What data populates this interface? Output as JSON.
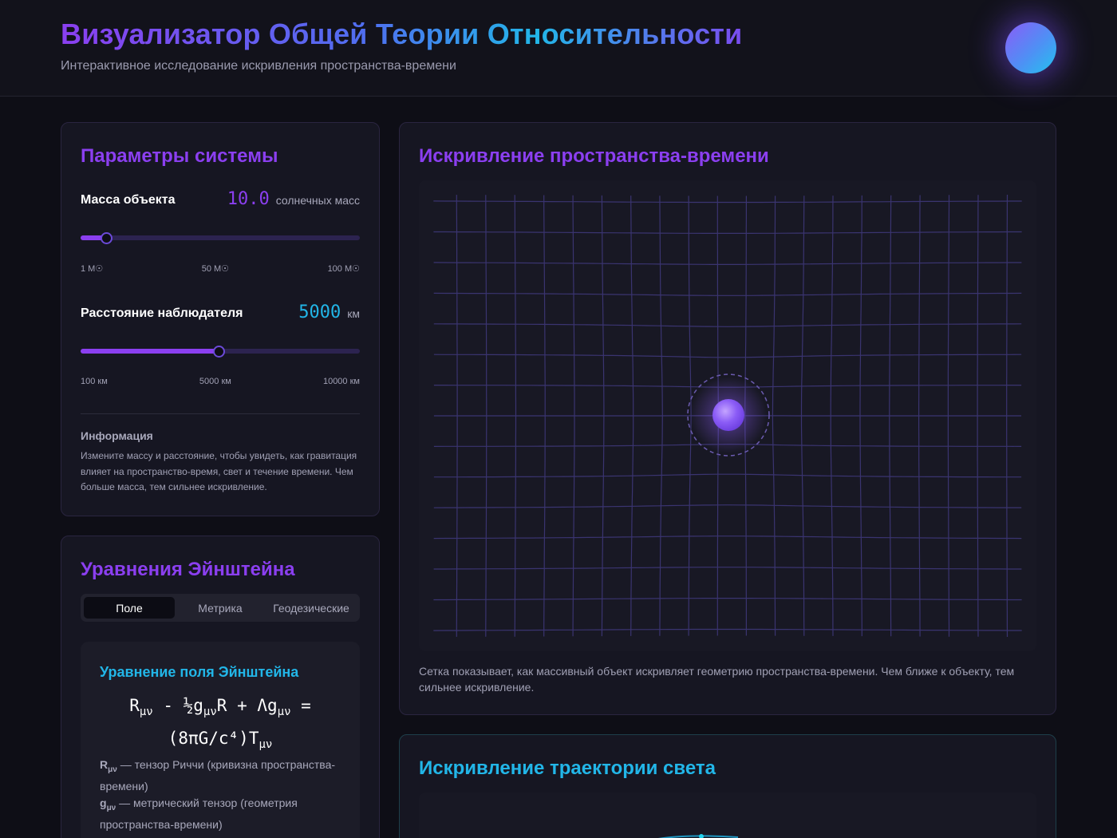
{
  "header": {
    "title": "Визуализатор Общей Теории Относительности",
    "subtitle": "Интерактивное исследование искривления пространства-времени"
  },
  "params": {
    "title": "Параметры системы",
    "mass": {
      "label": "Масса объекта",
      "value": "10.0",
      "unit": "солнечных масс",
      "fraction": 0.091,
      "ticks": [
        "1 M☉",
        "50 M☉",
        "100 M☉"
      ],
      "color": "#8b3ff0"
    },
    "distance": {
      "label": "Расстояние наблюдателя",
      "value": "5000",
      "unit": "км",
      "fraction": 0.495,
      "ticks": [
        "100 км",
        "5000 км",
        "10000 км"
      ],
      "color": "#22b6e8"
    },
    "info_heading": "Информация",
    "info_text": "Измените массу и расстояние, чтобы увидеть, как гравитация влияет на пространство-время, свет и течение времени. Чем больше масса, тем сильнее искривление."
  },
  "equations": {
    "title": "Уравнения Эйнштейна",
    "tabs": [
      {
        "label": "Поле",
        "active": true
      },
      {
        "label": "Метрика",
        "active": false
      },
      {
        "label": "Геодезические",
        "active": false
      }
    ],
    "field": {
      "title": "Уравнение поля Эйнштейна",
      "formula_line1_a": "R",
      "formula_line1_sub1": "μν",
      "formula_line1_b": " - ½g",
      "formula_line1_sub2": "μν",
      "formula_line1_c": "R + Λg",
      "formula_line1_sub3": "μν",
      "formula_line1_d": " =",
      "formula_line2_a": "(8πG/c⁴)T",
      "formula_line2_sub": "μν",
      "note1_symbol": "R",
      "note1_sub": "μν",
      "note1_text": " — тензор Риччи (кривизна пространства-времени)",
      "note2_symbol": "g",
      "note2_sub": "μν",
      "note2_text": " — метрический тензор (геометрия пространства-времени)"
    }
  },
  "spacetime": {
    "title": "Искривление пространства-времени",
    "caption": "Сетка показывает, как массивный объект искривляет геометрию пространства-времени. Чем ближе к объекту, тем сильнее искривление."
  },
  "light": {
    "title": "Искривление траектории света"
  },
  "colors": {
    "accent_purple": "#8b3ff0",
    "accent_cyan": "#22b6e8",
    "background": "#0e0e16",
    "card": "#161622"
  }
}
